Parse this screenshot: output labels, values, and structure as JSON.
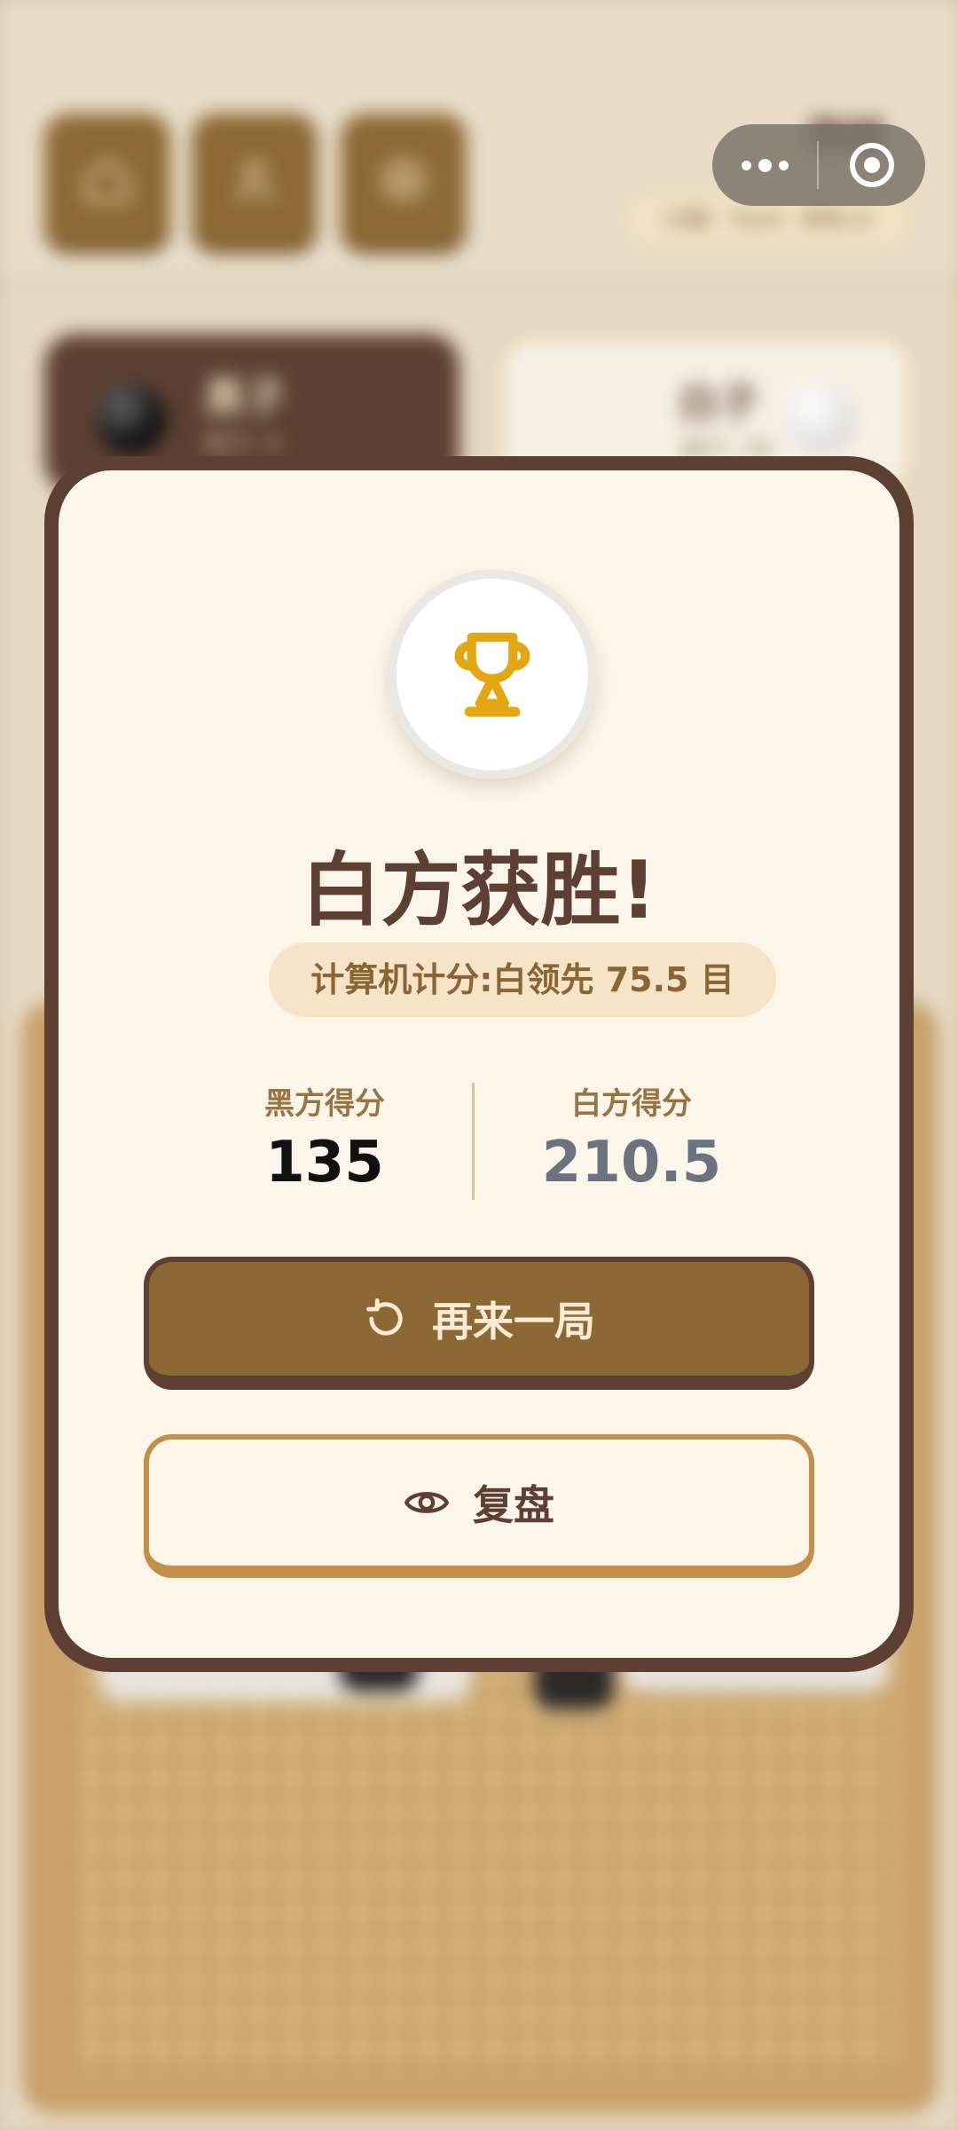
{
  "background": {
    "title": "围棋",
    "subtitle": "19路 · Hard · 拳电 AI",
    "black_player": {
      "name": "黑子",
      "caption": "提子: 4"
    },
    "white_player": {
      "name": "白子",
      "caption": "提子: 39"
    }
  },
  "nav_icons": [
    "home-icon",
    "user-icon",
    "settings-icon"
  ],
  "result": {
    "title": "白方获胜!",
    "detail": "计算机计分:白领先 75.5 目",
    "black_score_label": "黑方得分",
    "black_score": "135",
    "white_score_label": "白方得分",
    "white_score": "210.5"
  },
  "actions": {
    "play_again": "再来一局",
    "replay": "复盘"
  },
  "colors": {
    "brand_brown": "#5d4033",
    "button_gold": "#8c6835",
    "trophy": "#e3a714",
    "modal_bg": "#fbf5ea"
  }
}
